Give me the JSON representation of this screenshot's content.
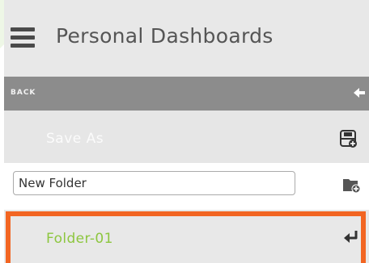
{
  "header": {
    "title": "Personal Dashboards",
    "menu_icon": "hamburger-menu-icon"
  },
  "back_bar": {
    "label": "BACK",
    "icon": "arrow-left-icon"
  },
  "save_as": {
    "label": "Save As",
    "icon": "save-disk-icon"
  },
  "new_folder": {
    "value": "New Folder",
    "icon": "new-folder-icon"
  },
  "folders": [
    {
      "label": "Folder-01",
      "icon": "enter-return-icon"
    }
  ],
  "colors": {
    "back_bar_bg": "#8c8c8c",
    "folder_label": "#8dc63f",
    "highlight_border": "#f26522"
  }
}
